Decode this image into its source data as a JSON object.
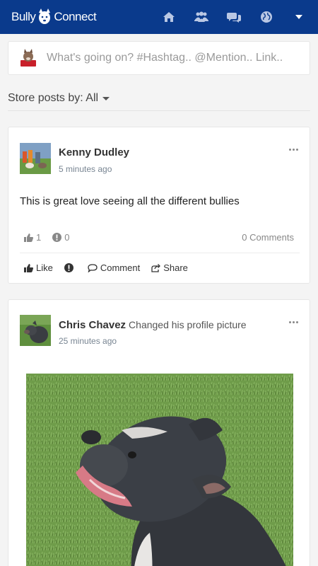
{
  "app": {
    "logo_left": "Bully",
    "logo_right": "Connect"
  },
  "nav": {
    "icons": [
      "home-icon",
      "users-icon",
      "chat-icon",
      "globe-icon",
      "caret-down-icon"
    ]
  },
  "composer": {
    "placeholder": "What's going on? #Hashtag.. @Mention.. Link.."
  },
  "sort": {
    "label": "Store posts by: All"
  },
  "posts": [
    {
      "author": "Kenny Dudley",
      "action": "",
      "time": "5 minutes ago",
      "text": "This is great love seeing all the different bullies",
      "likes": "1",
      "reports": "0",
      "comments": "0 Comments",
      "actions": {
        "like": "Like",
        "comment": "Comment",
        "share": "Share"
      }
    },
    {
      "author": "Chris Chavez",
      "action": "Changed his profile picture",
      "time": "25 minutes ago"
    }
  ],
  "colors": {
    "header": "#0a3a8c",
    "nav_icon": "#b9c7e4"
  }
}
